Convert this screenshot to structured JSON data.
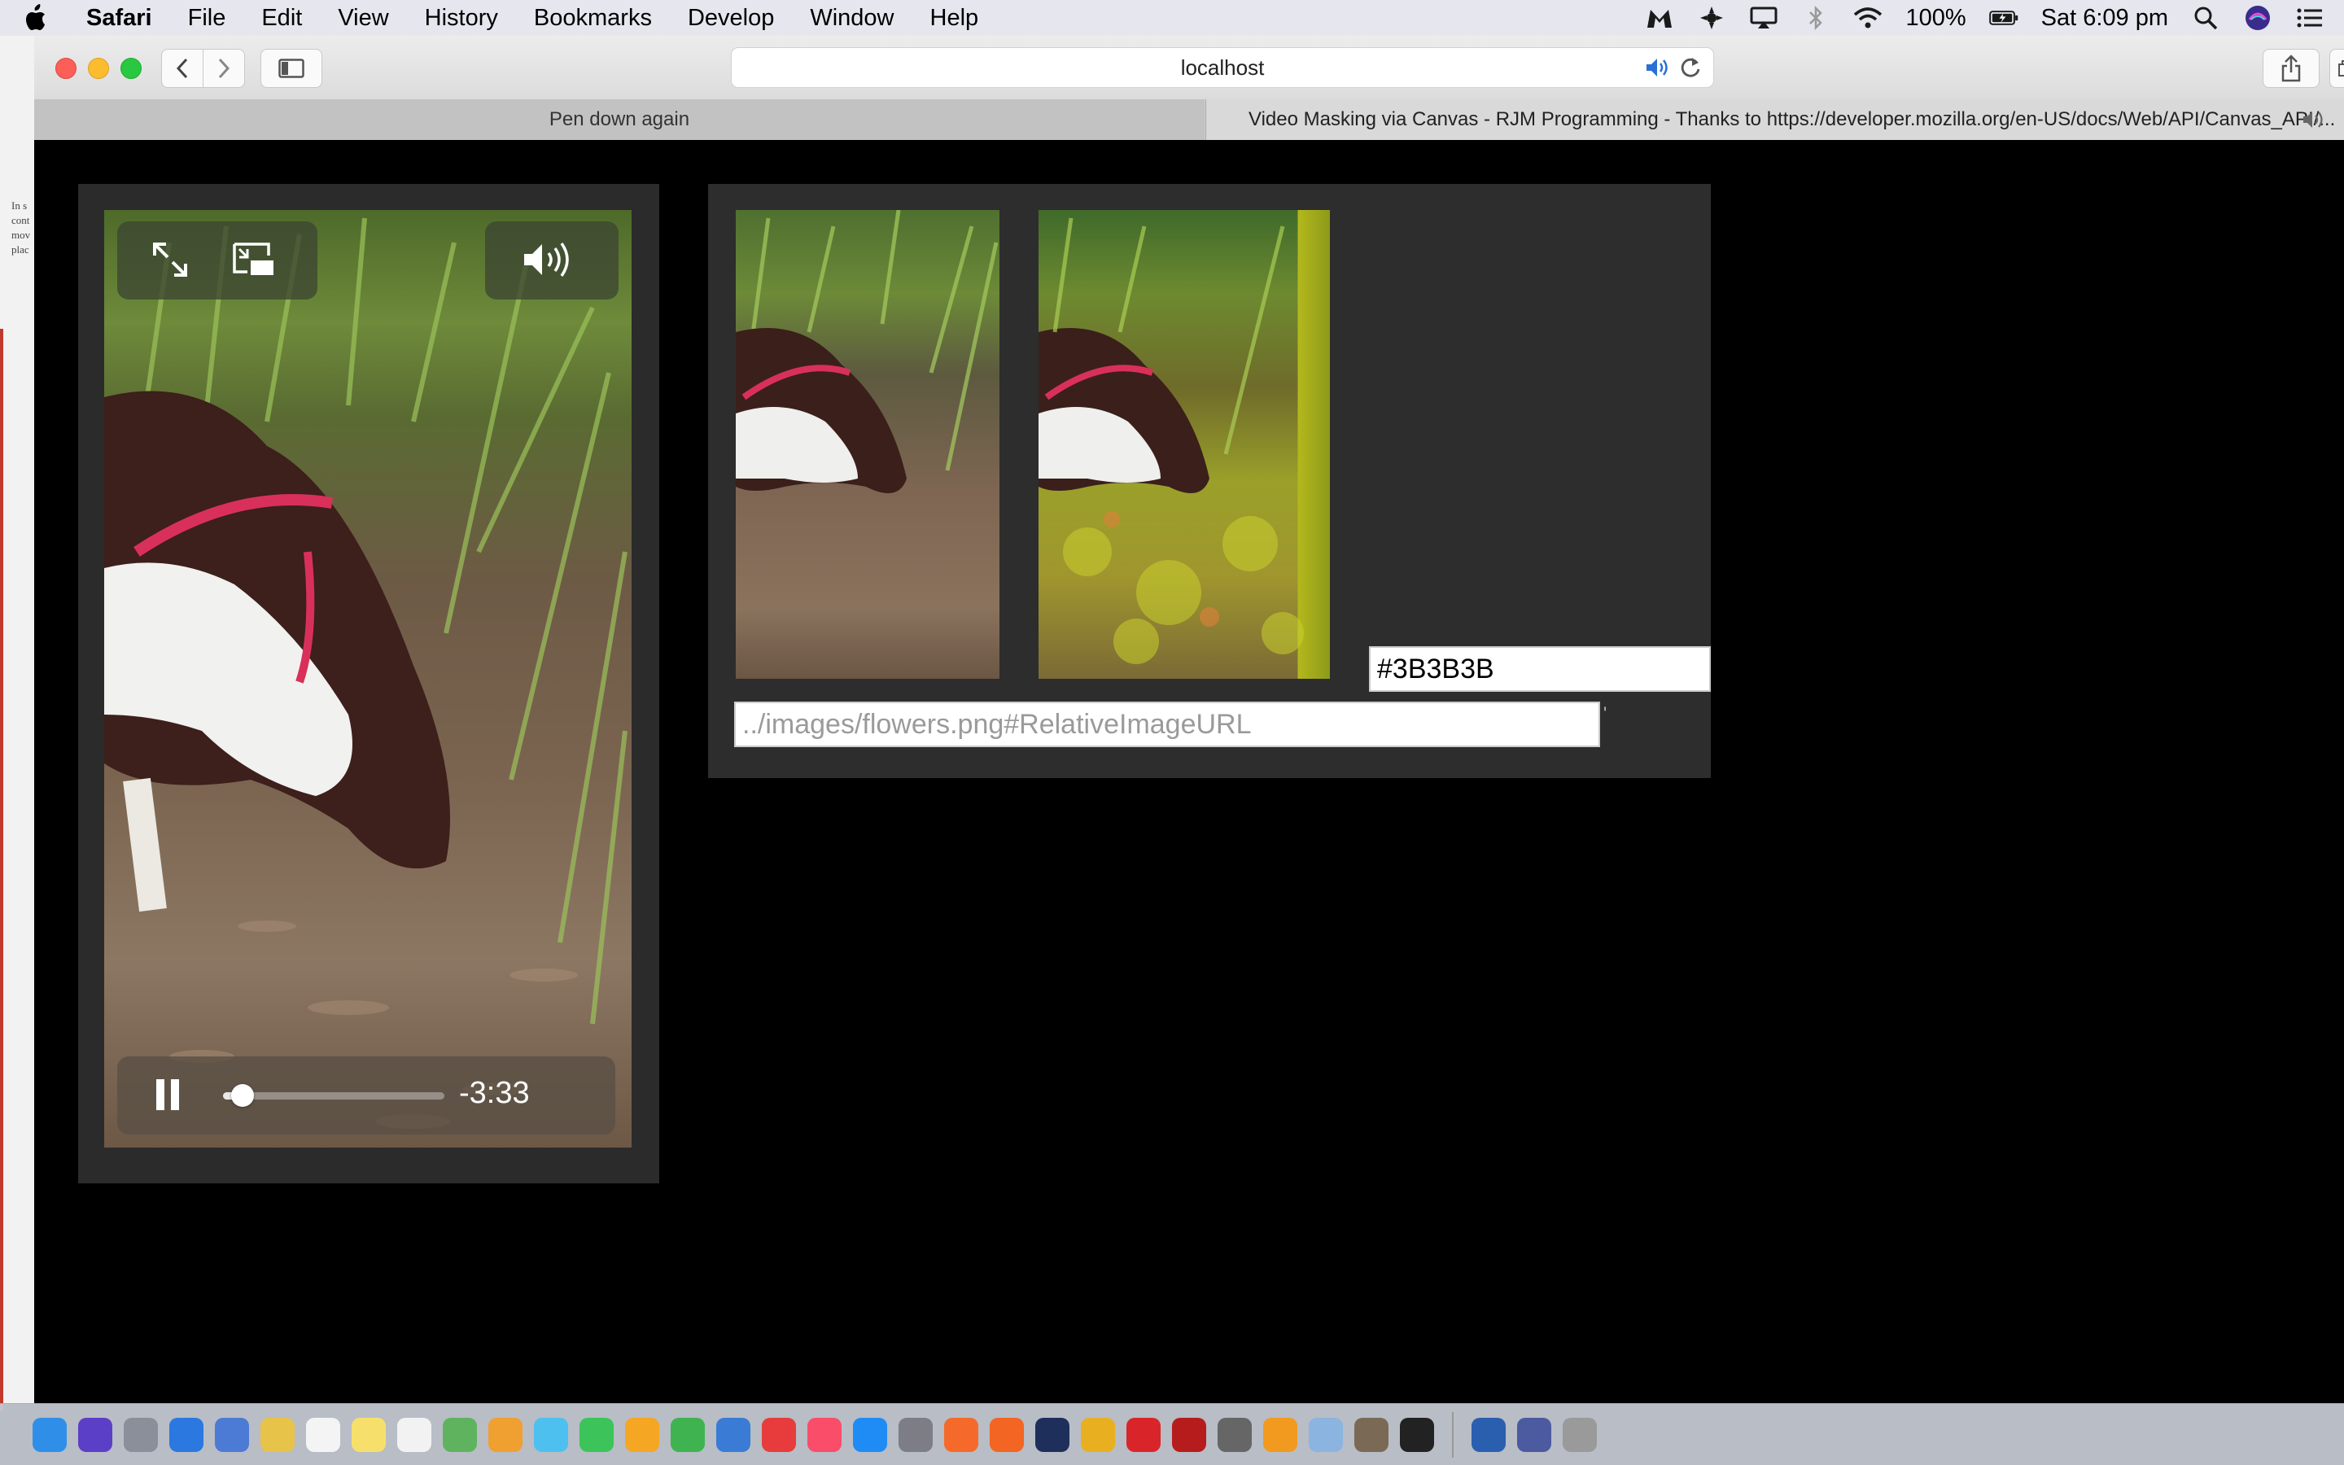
{
  "menubar": {
    "app_name": "Safari",
    "items": [
      "File",
      "Edit",
      "View",
      "History",
      "Bookmarks",
      "Develop",
      "Window",
      "Help"
    ],
    "battery": "100%",
    "clock": "Sat 6:09 pm"
  },
  "background_window": {
    "text": "In s cont mov plac"
  },
  "browser": {
    "address": "localhost",
    "tabs": [
      {
        "label": "Pen down again"
      },
      {
        "label": "Video Masking via Canvas - RJM Programming - Thanks to https://developer.mozilla.org/en-US/docs/Web/API/Canvas_API/..."
      }
    ]
  },
  "video_player": {
    "time_remaining": "-3:33",
    "progress_fraction": 0.09,
    "state": "playing"
  },
  "masking": {
    "color_value": "#3B3B3B",
    "url_placeholder": "../images/flowers.png#RelativeImageURL",
    "caret_char": "'"
  },
  "colors": {
    "page_bg": "#000000",
    "panel_bg": "#2b2b2b",
    "mask_color": "#3B3B3B"
  },
  "dock": {
    "icons": [
      "finder-icon",
      "siri-icon",
      "launchpad-icon",
      "safari-icon",
      "preview-icon",
      "notes-icon",
      "calendar-icon",
      "stickies-icon",
      "reminders-icon",
      "maps-icon",
      "photos-icon",
      "messages-icon",
      "facetime-icon",
      "pages-icon",
      "numbers-icon",
      "keynote-icon",
      "news-icon",
      "music-icon",
      "app-store-icon",
      "system-preferences-icon",
      "aa-icon",
      "firefox-icon",
      "photoshop-icon",
      "chrome-icon",
      "opera-icon",
      "filezilla-icon",
      "mammoth-icon",
      "xampp-icon",
      "paintbrush-icon",
      "gimp-icon",
      "terminal-icon",
      "quicktime-icon",
      "network-icon",
      "activity-icon"
    ]
  }
}
